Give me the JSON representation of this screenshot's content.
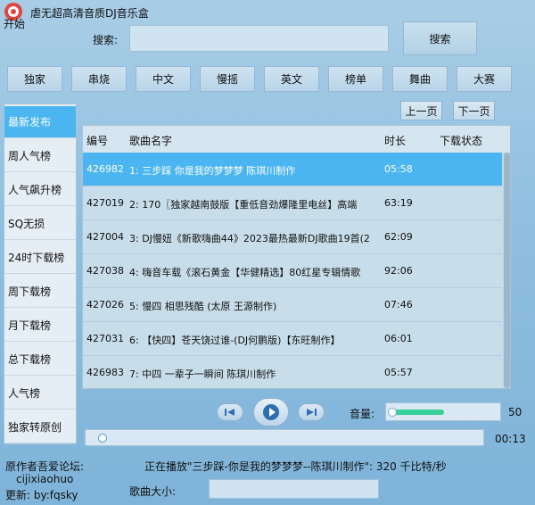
{
  "app": {
    "title": "虐无超高清音质DJ音乐盒",
    "start_label": "开始"
  },
  "search": {
    "label": "搜索:",
    "value": "",
    "button_label": "搜索"
  },
  "categories": [
    "独家",
    "串烧",
    "中文",
    "慢摇",
    "英文",
    "榜单",
    "舞曲",
    "大赛"
  ],
  "sidebar": {
    "items": [
      {
        "label": "最新发布",
        "active": true
      },
      {
        "label": "周人气榜"
      },
      {
        "label": "人气飙升榜"
      },
      {
        "label": "SQ无损"
      },
      {
        "label": "24时下载榜"
      },
      {
        "label": "周下载榜"
      },
      {
        "label": "月下载榜"
      },
      {
        "label": "总下载榜"
      },
      {
        "label": "人气榜"
      },
      {
        "label": "独家转原创"
      }
    ]
  },
  "paging": {
    "prev_label": "上一页",
    "next_label": "下一页"
  },
  "table": {
    "headers": [
      "编号",
      "歌曲名字",
      "时长",
      "下载状态"
    ],
    "rows": [
      {
        "id": "426982",
        "name": "1: 三步踩  你是我的梦梦梦  陈琪川制作",
        "duration": "05:58",
        "status": "",
        "selected": true
      },
      {
        "id": "427019",
        "name": "2: 170〖独家越南鼓版【重低音劲爆隆里电丝】高端",
        "duration": "63:19",
        "status": ""
      },
      {
        "id": "427004",
        "name": "3: DJ慢妞《新歌嗨曲44》2023最热最新DJ歌曲19首(2",
        "duration": "62:09",
        "status": ""
      },
      {
        "id": "427038",
        "name": "4: 嗨音车载《滚石黄金【华健精选】80红星专辑情歌",
        "duration": "92:06",
        "status": ""
      },
      {
        "id": "427026",
        "name": "5: 慢四  相思残酷 (太原 王源制作)",
        "duration": "07:46",
        "status": ""
      },
      {
        "id": "427031",
        "name": "6: 【快四】苍天饶过谁-(DJ何鹏版)【东旺制作】",
        "duration": "06:01",
        "status": ""
      },
      {
        "id": "426983",
        "name": "7: 中四   一辈子一瞬间  陈琪川制作",
        "duration": "05:57",
        "status": ""
      }
    ]
  },
  "player": {
    "volume_label": "音量:",
    "volume_value": "50",
    "volume_level": 0.5,
    "time": "00:13",
    "progress": 0.02
  },
  "footer": {
    "author_label": "原作者吾爱论坛:",
    "author_name": "cijixiaohuo",
    "updated_label": "更新:  by:fqsky",
    "now_playing": "正在播放\"三步踩-你是我的梦梦梦--陈琪川制作\": 320 千比特/秒",
    "size_label": "歌曲大小:"
  }
}
